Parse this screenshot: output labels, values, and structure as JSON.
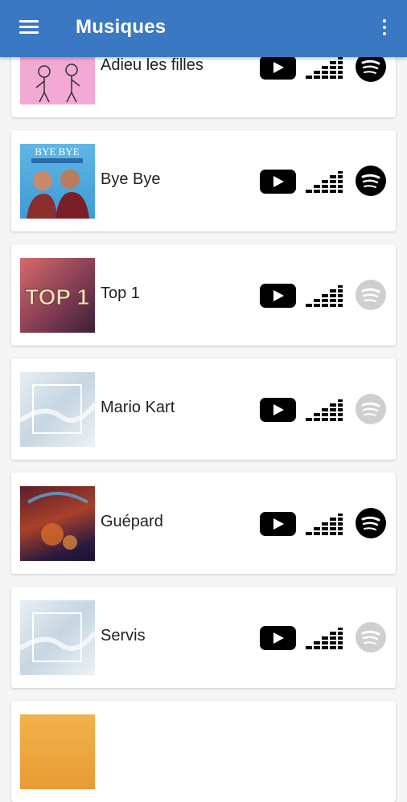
{
  "header": {
    "title": "Musiques",
    "menu_icon": "hamburger-menu-icon",
    "more_icon": "more-vertical-icon",
    "bar_color": "#3a78c3"
  },
  "songs": [
    {
      "title": "Adieu les filles",
      "spotify_available": true
    },
    {
      "title": "Bye Bye",
      "spotify_available": true,
      "cover_text": "BYE BYE"
    },
    {
      "title": "Top 1",
      "spotify_available": false,
      "cover_text": "TOP 1"
    },
    {
      "title": "Mario Kart",
      "spotify_available": false
    },
    {
      "title": "Guépard",
      "spotify_available": true
    },
    {
      "title": "Servis",
      "spotify_available": false
    }
  ],
  "icons": {
    "video": "youtube-icon",
    "deezer": "deezer-icon",
    "spotify": "spotify-icon",
    "active_color": "#000000",
    "disabled_color": "#cfcfcf"
  }
}
